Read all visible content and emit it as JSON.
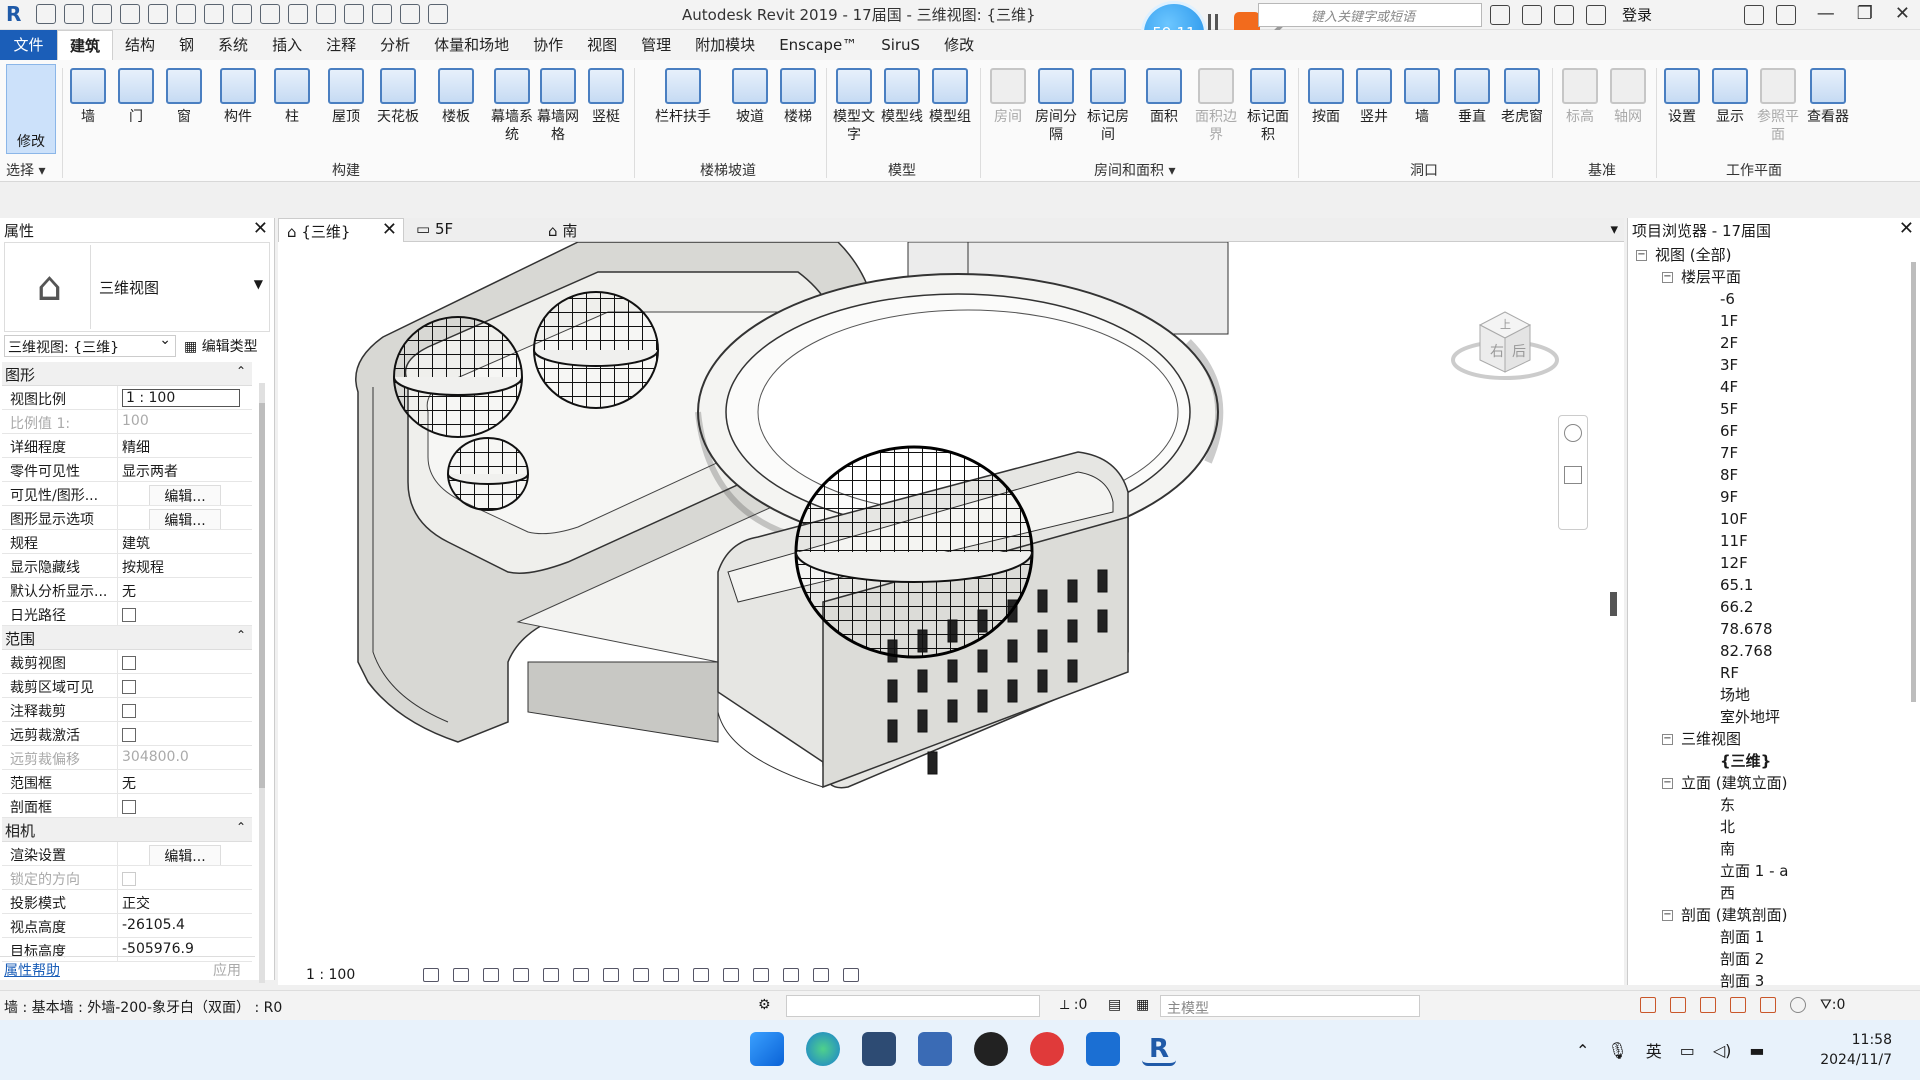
{
  "titlebar": {
    "title": "Autodesk Revit 2019 - 17届国 - 三维视图: {三维}",
    "recorder_time": "59:11",
    "search_placeholder": "键入关键字或短语",
    "login": "登录"
  },
  "menu": {
    "file": "文件",
    "tabs": [
      "建筑",
      "结构",
      "钢",
      "系统",
      "插入",
      "注释",
      "分析",
      "体量和场地",
      "协作",
      "视图",
      "管理",
      "附加模块",
      "Enscape™",
      "SiruS",
      "修改"
    ]
  },
  "ribbon": {
    "modify": "修改",
    "select_label": "选择",
    "groups": {
      "build": "构建",
      "circulation": "楼梯坡道",
      "model": "模型",
      "room_area": "房间和面积",
      "opening": "洞口",
      "datum": "基准",
      "workplane": "工作平面"
    },
    "buttons": [
      "墙",
      "门",
      "窗",
      "构件",
      "柱",
      "屋顶",
      "天花板",
      "楼板",
      "幕墙系统",
      "幕墙网格",
      "竖梃",
      "栏杆扶手",
      "坡道",
      "楼梯",
      "模型文字",
      "模型线",
      "模型组",
      "房间",
      "房间分隔",
      "标记房间",
      "面积",
      "面积边界",
      "标记面积",
      "按面",
      "竖井",
      "墙",
      "垂直",
      "老虎窗",
      "标高",
      "轴网",
      "设置",
      "显示",
      "参照平面",
      "查看器"
    ]
  },
  "properties": {
    "title": "属性",
    "type_name": "三维视图",
    "view_selector": "三维视图: {三维}",
    "edit_type": "编辑类型",
    "sections": [
      {
        "name": "图形",
        "rows": [
          {
            "k": "视图比例",
            "v": "1 : 100",
            "kind": "input"
          },
          {
            "k": "比例值 1:",
            "v": "100",
            "kind": "disabled"
          },
          {
            "k": "详细程度",
            "v": "精细"
          },
          {
            "k": "零件可见性",
            "v": "显示两者"
          },
          {
            "k": "可见性/图形...",
            "v": "编辑...",
            "kind": "btn"
          },
          {
            "k": "图形显示选项",
            "v": "编辑...",
            "kind": "btn"
          },
          {
            "k": "规程",
            "v": "建筑"
          },
          {
            "k": "显示隐藏线",
            "v": "按规程"
          },
          {
            "k": "默认分析显示...",
            "v": "无"
          },
          {
            "k": "日光路径",
            "v": "",
            "kind": "check"
          }
        ]
      },
      {
        "name": "范围",
        "rows": [
          {
            "k": "裁剪视图",
            "v": "",
            "kind": "check"
          },
          {
            "k": "裁剪区域可见",
            "v": "",
            "kind": "check"
          },
          {
            "k": "注释裁剪",
            "v": "",
            "kind": "check"
          },
          {
            "k": "远剪裁激活",
            "v": "",
            "kind": "check"
          },
          {
            "k": "远剪裁偏移",
            "v": "304800.0",
            "kind": "disabled"
          },
          {
            "k": "范围框",
            "v": "无"
          },
          {
            "k": "剖面框",
            "v": "",
            "kind": "check"
          }
        ]
      },
      {
        "name": "相机",
        "rows": [
          {
            "k": "渲染设置",
            "v": "编辑...",
            "kind": "btn"
          },
          {
            "k": "锁定的方向",
            "v": "",
            "kind": "check-disabled"
          },
          {
            "k": "投影模式",
            "v": "正交"
          },
          {
            "k": "视点高度",
            "v": "-26105.4"
          },
          {
            "k": "目标高度",
            "v": "-505976.9"
          }
        ]
      }
    ],
    "help": "属性帮助",
    "apply": "应用"
  },
  "view_tabs": [
    "{三维}",
    "5F",
    "南"
  ],
  "view_cube": {
    "left": "右",
    "right": "后",
    "top": "上"
  },
  "view_control": {
    "scale": "1 : 100"
  },
  "browser": {
    "title": "项目浏览器 - 17届国",
    "tree": [
      {
        "level": 1,
        "toggle": "−",
        "label": "视图 (全部)"
      },
      {
        "level": 2,
        "toggle": "−",
        "label": "楼层平面"
      },
      {
        "level": 3,
        "label": "-6"
      },
      {
        "level": 3,
        "label": "1F"
      },
      {
        "level": 3,
        "label": "2F"
      },
      {
        "level": 3,
        "label": "3F"
      },
      {
        "level": 3,
        "label": "4F"
      },
      {
        "level": 3,
        "label": "5F"
      },
      {
        "level": 3,
        "label": "6F"
      },
      {
        "level": 3,
        "label": "7F"
      },
      {
        "level": 3,
        "label": "8F"
      },
      {
        "level": 3,
        "label": "9F"
      },
      {
        "level": 3,
        "label": "10F"
      },
      {
        "level": 3,
        "label": "11F"
      },
      {
        "level": 3,
        "label": "12F"
      },
      {
        "level": 3,
        "label": "65.1"
      },
      {
        "level": 3,
        "label": "66.2"
      },
      {
        "level": 3,
        "label": "78.678"
      },
      {
        "level": 3,
        "label": "82.768"
      },
      {
        "level": 3,
        "label": "RF"
      },
      {
        "level": 3,
        "label": "场地"
      },
      {
        "level": 3,
        "label": "室外地坪"
      },
      {
        "level": 2,
        "toggle": "−",
        "label": "三维视图"
      },
      {
        "level": 3,
        "label": "{三维}",
        "bold": true
      },
      {
        "level": 2,
        "toggle": "−",
        "label": "立面 (建筑立面)"
      },
      {
        "level": 3,
        "label": "东"
      },
      {
        "level": 3,
        "label": "北"
      },
      {
        "level": 3,
        "label": "南"
      },
      {
        "level": 3,
        "label": "立面 1 - a"
      },
      {
        "level": 3,
        "label": "西"
      },
      {
        "level": 2,
        "toggle": "−",
        "label": "剖面 (建筑剖面)"
      },
      {
        "level": 3,
        "label": "剖面 1"
      },
      {
        "level": 3,
        "label": "剖面 2"
      },
      {
        "level": 3,
        "label": "剖面 3"
      }
    ]
  },
  "status": {
    "text": "墙 : 基本墙 : 外墙-200-象牙白（双面） : R0",
    "zero": ":0",
    "model": "主模型",
    "filter": ":0"
  },
  "taskbar": {
    "ime": "英",
    "time": "11:58",
    "date": "2024/11/7"
  },
  "colors": {
    "file_tab": "#1b5eb8",
    "accent": "#4a7fc1",
    "stop": "#f26b1d"
  }
}
